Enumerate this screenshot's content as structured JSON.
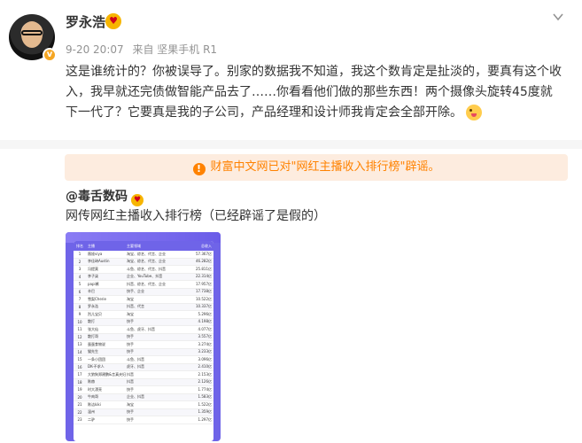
{
  "author": {
    "name": "罗永浩",
    "vip_glyph": "♥",
    "verified_glyph": "v",
    "timestamp": "9-20 20:07",
    "source": "来自 坚果手机 R1"
  },
  "post": {
    "text": "这是谁统计的？你被误导了。别家的数据我不知道，我这个数肯定是扯淡的，要真有这个收入，我早就还完债做智能产品去了……你看看他们做的那些东西！两个摄像头旋转45度就下一代了？它要真是我的子公司，产品经理和设计师我肯定会全部开除。",
    "emoji": "tongue-wink-emoji"
  },
  "notice": {
    "icon_glyph": "!",
    "text": "财富中文网已对\"网红主播收入排行榜\"辟谣。"
  },
  "repost": {
    "author": "@毒舌数码",
    "vip_glyph": "♥",
    "text": "网传网红主播收入排行榜（已经辟谣了是假的）"
  },
  "ranking": {
    "headers": [
      "排名",
      "主播",
      "主要领域",
      "总收入"
    ],
    "rows": [
      [
        "1",
        "薇娅viya",
        "淘宝、综艺、代言、企业",
        "57.367亿"
      ],
      [
        "2",
        "李佳琦Austin",
        "淘宝、综艺、代言、企业",
        "46.282亿"
      ],
      [
        "3",
        "冯提莫",
        "斗鱼、综艺、代言、抖音",
        "25.811亿"
      ],
      [
        "4",
        "李子柒",
        "企业、YouTube、抖音",
        "22.314亿"
      ],
      [
        "5",
        "papi酱",
        "抖音、综艺、代言、企业",
        "17.957亿"
      ],
      [
        "6",
        "辛巴",
        "快手、企业",
        "17.738亿"
      ],
      [
        "7",
        "雪梨Cherie",
        "淘宝",
        "10.522亿"
      ],
      [
        "8",
        "罗永浩",
        "抖音、代言",
        "10.337亿"
      ],
      [
        "9",
        "烈儿宝贝",
        "淘宝",
        "5.296亿"
      ],
      [
        "10",
        "散打",
        "快手",
        "4.198亿"
      ],
      [
        "11",
        "张大仙",
        "斗鱼、虎牙、抖音",
        "4.077亿"
      ],
      [
        "12",
        "散打哥",
        "快手",
        "3.557亿"
      ],
      [
        "13",
        "蛋蛋食物说",
        "快手",
        "3.274亿"
      ],
      [
        "14",
        "猫先生",
        "快手",
        "3.233亿"
      ],
      [
        "15",
        "一条小团团",
        "斗鱼、抖音",
        "3.096亿"
      ],
      [
        "16",
        "DK-不求人",
        "虎牙、抖音",
        "2.410亿"
      ],
      [
        "17",
        "大狼狗郑建鹏&言真夫妇",
        "抖音",
        "2.153亿"
      ],
      [
        "18",
        "陈赫",
        "抖音",
        "2.126亿"
      ],
      [
        "19",
        "时大漂亮",
        "快手",
        "1.774亿"
      ],
      [
        "20",
        "牛肉哥",
        "企业、抖音",
        "1.583亿"
      ],
      [
        "21",
        "陈洁kiki",
        "淘宝",
        "1.522亿"
      ],
      [
        "22",
        "温州",
        "快手",
        "1.359亿"
      ],
      [
        "23",
        "二驴",
        "快手",
        "1.297亿"
      ]
    ]
  },
  "colors": {
    "accent_orange": "#ff8200",
    "notice_bg": "#fdecdf",
    "card_purple": "#6f64e8"
  }
}
